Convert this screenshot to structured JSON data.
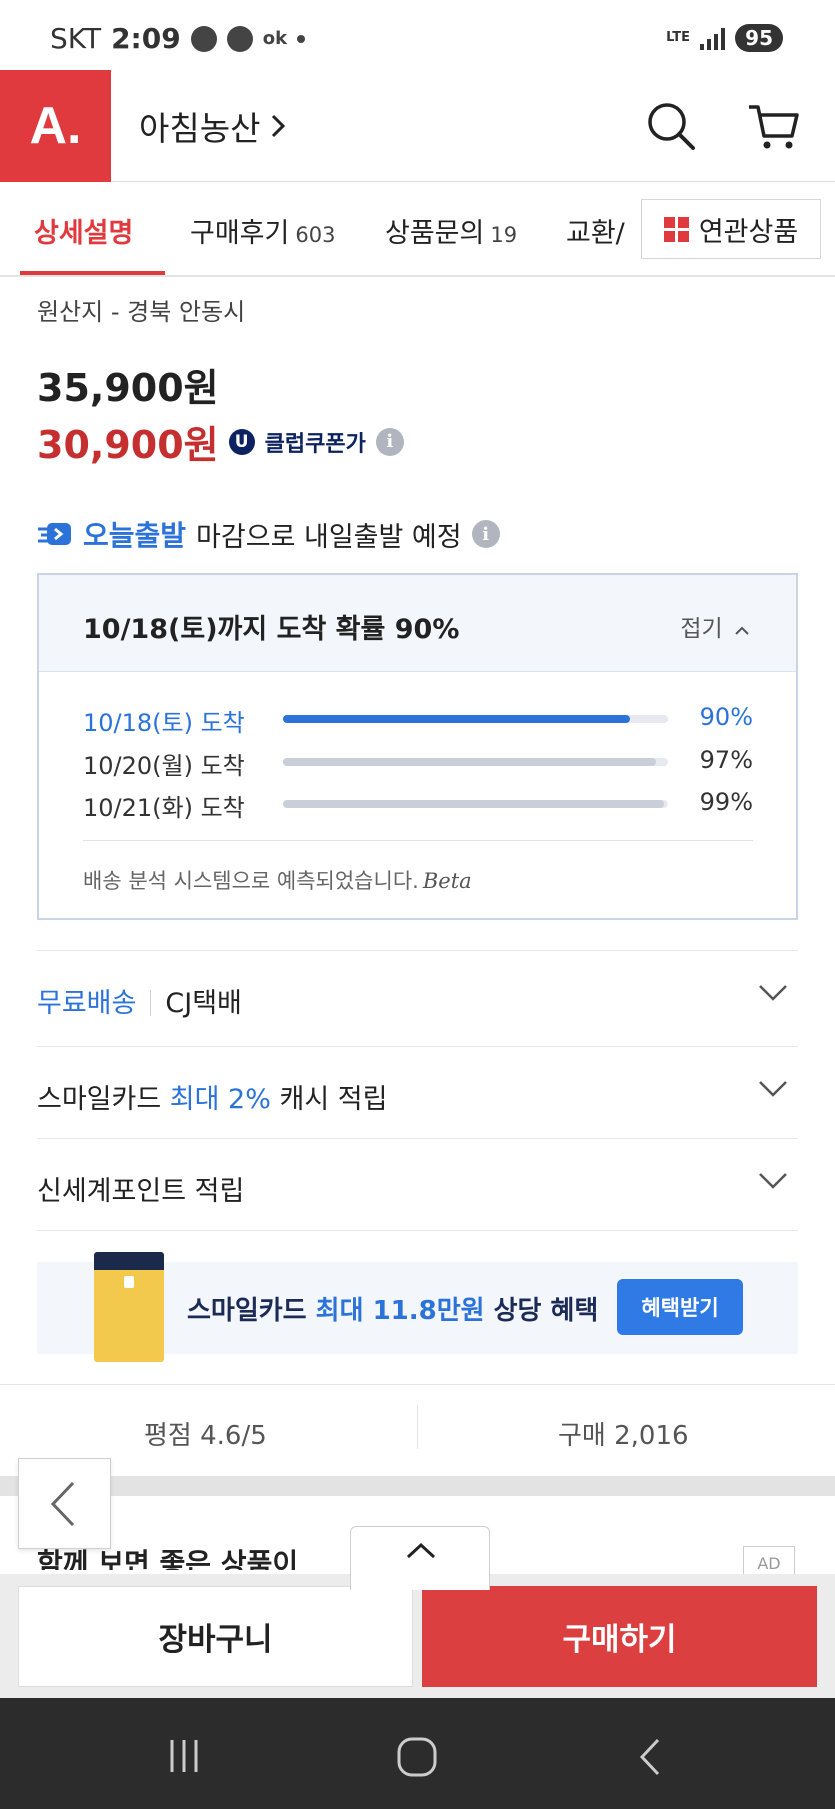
{
  "status_bar": {
    "carrier": "SKT",
    "time": "2:09",
    "ok_label": "ok",
    "network": "LTE",
    "battery": "95"
  },
  "header": {
    "logo": "A.",
    "store_name": "아침농산",
    "search_icon": "search-icon",
    "cart_icon": "cart-icon",
    "brand_color": "#e0393e"
  },
  "tabs": {
    "items": [
      {
        "label": "상세설명",
        "count": ""
      },
      {
        "label": "구매후기",
        "count": "603"
      },
      {
        "label": "상품문의",
        "count": "19"
      },
      {
        "label": "교환/",
        "count": ""
      }
    ],
    "active_index": 0,
    "related_label": "연관상품"
  },
  "product": {
    "origin": "원산지 - 경북 안동시",
    "price_original": "35,900원",
    "price_sale": "30,900원",
    "club_badge": "U",
    "club_label": "클럽쿠폰가",
    "sale_color": "#c62f2f"
  },
  "shipping": {
    "badge": "오늘출발",
    "text": "마감으로 내일출발 예정"
  },
  "arrival_probability": {
    "title": "10/18(토)까지 도착 확률 90%",
    "fold_label": "접기",
    "rows": [
      {
        "label": "10/18(토) 도착",
        "percent": 90,
        "percent_label": "90%",
        "highlight": true
      },
      {
        "label": "10/20(월) 도착",
        "percent": 97,
        "percent_label": "97%",
        "highlight": false
      },
      {
        "label": "10/21(화) 도착",
        "percent": 99,
        "percent_label": "99%",
        "highlight": false
      }
    ],
    "note": "배송 분석 시스템으로 예측되었습니다.",
    "beta": "Beta",
    "accent_color": "#2b73d9"
  },
  "benefits": {
    "delivery_free": "무료배송",
    "delivery_carrier": "CJ택배",
    "smilecard_prefix": "스마일카드",
    "smilecard_highlight": "최대 2%",
    "smilecard_suffix": "캐시 적립",
    "shinsegae": "신세계포인트 적립"
  },
  "banner": {
    "prefix": "스마일카드",
    "highlight": "최대 11.8만원",
    "suffix": "상당 혜택",
    "button": "혜택받기"
  },
  "stats": {
    "rating": "평점 4.6/5",
    "purchases": "구매 2,016"
  },
  "recommend": {
    "title": "함께 보면 좋은 상품이",
    "ad": "AD"
  },
  "bottom": {
    "cart": "장바구니",
    "buy": "구매하기",
    "buy_color": "#dc3f3f"
  }
}
